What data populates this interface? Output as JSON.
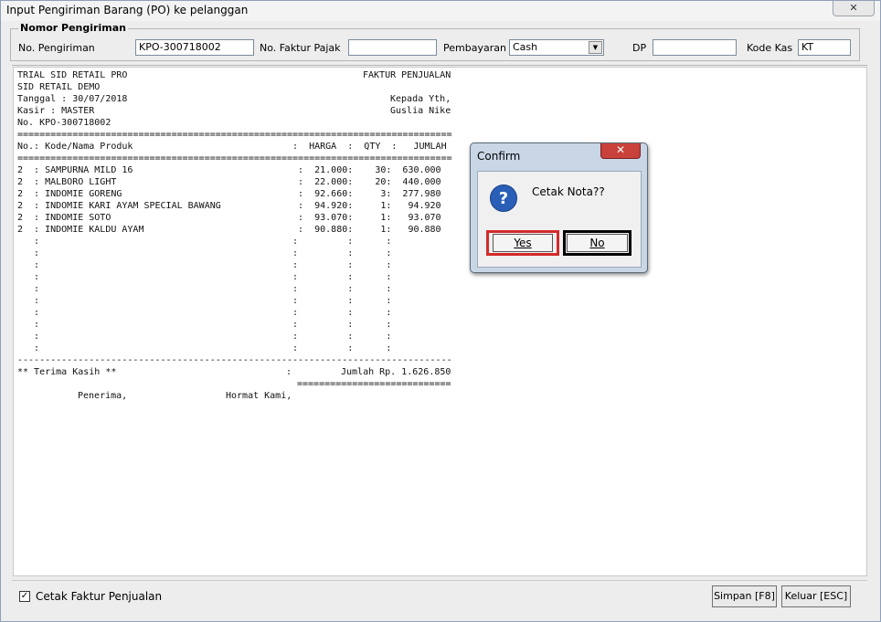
{
  "window": {
    "title": "Input Pengiriman Barang (PO) ke pelanggan",
    "close_glyph": "✕"
  },
  "header": {
    "group_title": "Nomor Pengiriman",
    "no_pengiriman_label": "No. Pengiriman",
    "no_pengiriman_value": "KPO-300718002",
    "no_faktur_pajak_label": "No. Faktur Pajak",
    "no_faktur_pajak_value": "",
    "pembayaran_label": "Pembayaran",
    "pembayaran_value": "Cash",
    "dp_label": "DP",
    "dp_value": "",
    "kode_kas_label": "Kode Kas",
    "kode_kas_value": "KT"
  },
  "report": {
    "company": "TRIAL SID RETAIL PRO",
    "doc_title": "FAKTUR PENJUALAN",
    "store": "SID RETAIL DEMO",
    "tanggal": "Tanggal : 30/07/2018",
    "kepada": "Kepada Yth,",
    "kasir": "Kasir : MASTER",
    "customer": "Guslia Nike",
    "no": "No. KPO-300718002",
    "separator_double": "===============================================================================",
    "col_header": "No.: Kode/Nama Produk                             :  HARGA  :  QTY  :   JUMLAH",
    "rows": [
      "2  : SAMPURNA MILD 16                              :  21.000:    30:  630.000",
      "2  : MALBORO LIGHT                                 :  22.000:    20:  440.000",
      "2  : INDOMIE GORENG                                :  92.660:     3:  277.980",
      "2  : INDOMIE KARI AYAM SPECIAL BAWANG              :  94.920:     1:   94.920",
      "2  : INDOMIE SOTO                                  :  93.070:     1:   93.070",
      "2  : INDOMIE KALDU AYAM                            :  90.880:     1:   90.880"
    ],
    "empty_rows": [
      "   :                                              :         :      :",
      "   :                                              :         :      :",
      "   :                                              :         :      :",
      "   :                                              :         :      :",
      "   :                                              :         :      :",
      "   :                                              :         :      :",
      "   :                                              :         :      :",
      "   :                                              :         :      :",
      "   :                                              :         :      :",
      "   :                                              :         :      :"
    ],
    "separator_single": "-------------------------------------------------------------------------------",
    "terima_kasih": "** Terima Kasih **",
    "colon": ":",
    "jumlah": "Jumlah Rp. 1.626.850",
    "total_underline": "============================",
    "penerima": "Penerima,",
    "hormat_kami": "Hormat Kami,"
  },
  "footer": {
    "checkbox_label": "Cetak Faktur Penjualan",
    "check_glyph": "✓",
    "simpan_label": "Simpan [F8]",
    "keluar_label": "Keluar [ESC]"
  },
  "dialog": {
    "title": "Confirm",
    "close_glyph": "✕",
    "icon_glyph": "?",
    "message": "Cetak Nota??",
    "yes_label": "Yes",
    "no_label": "No"
  }
}
